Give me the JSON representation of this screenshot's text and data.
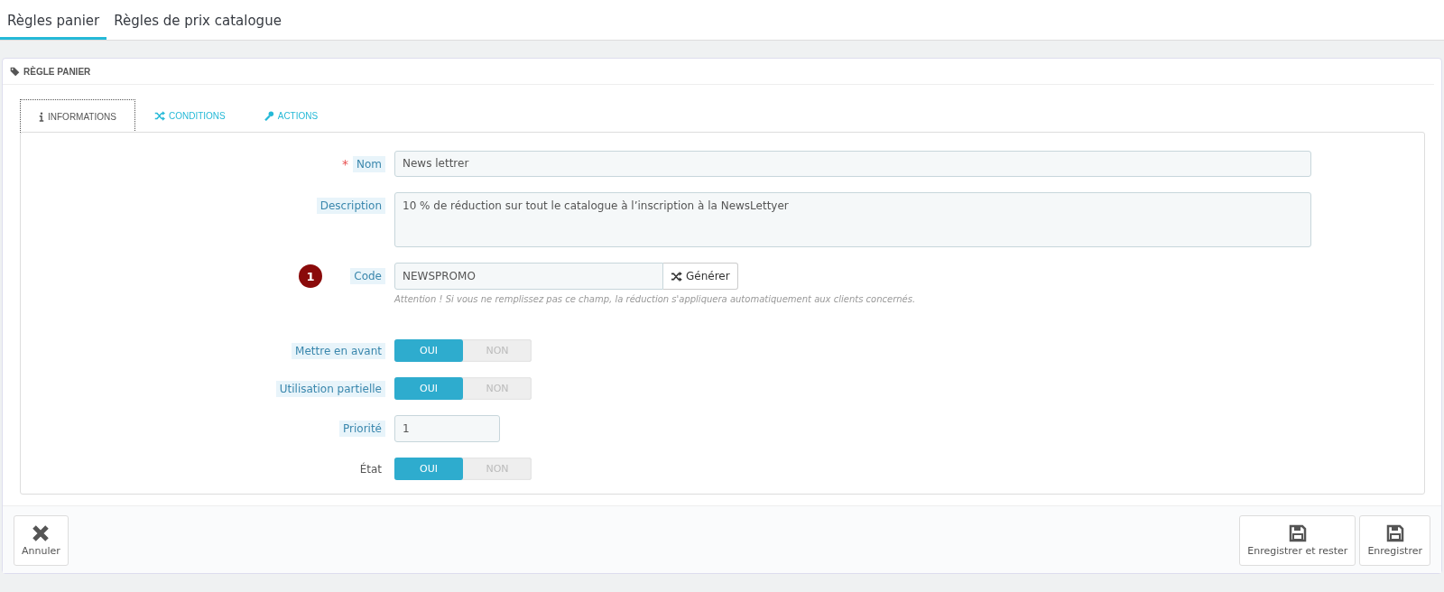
{
  "top_tabs": [
    {
      "label": "Règles panier",
      "selected": true
    },
    {
      "label": "Règles de prix catalogue",
      "selected": false
    }
  ],
  "panel": {
    "title": "RÈGLE PANIER"
  },
  "tabs": [
    {
      "label": "INFORMATIONS",
      "selected": true
    },
    {
      "label": "CONDITIONS",
      "selected": false
    },
    {
      "label": "ACTIONS",
      "selected": false
    }
  ],
  "fields": [
    {
      "kind": "text",
      "label": "Nom",
      "required_mark": "*",
      "help": true,
      "value": "News lettrer"
    },
    {
      "kind": "textarea",
      "label": "Description",
      "help": true,
      "value": "10 % de réduction sur tout le catalogue à l’inscription à la NewsLettyer"
    },
    {
      "kind": "code",
      "label": "Code",
      "help": true,
      "value": "NEWSPROMO",
      "badge": "1",
      "button": "Générer",
      "hint": "Attention ! Si vous ne remplissez pas ce champ, la réduction s'appliquera automatiquement aux clients concernés."
    },
    {
      "kind": "switch",
      "label": "Mettre en avant",
      "help": true,
      "options": [
        {
          "label": "OUI",
          "selected": true
        },
        {
          "label": "NON",
          "selected": false
        }
      ]
    },
    {
      "kind": "switch",
      "label": "Utilisation partielle",
      "help": true,
      "options": [
        {
          "label": "OUI",
          "selected": true
        },
        {
          "label": "NON",
          "selected": false
        }
      ]
    },
    {
      "kind": "number",
      "label": "Priorité",
      "help": true,
      "value": "1"
    },
    {
      "kind": "switch",
      "label": "État",
      "help": false,
      "options": [
        {
          "label": "OUI",
          "selected": true
        },
        {
          "label": "NON",
          "selected": false
        }
      ]
    }
  ],
  "footer": {
    "cancel": "Annuler",
    "save_stay": "Enregistrer et rester",
    "save": "Enregistrer"
  }
}
